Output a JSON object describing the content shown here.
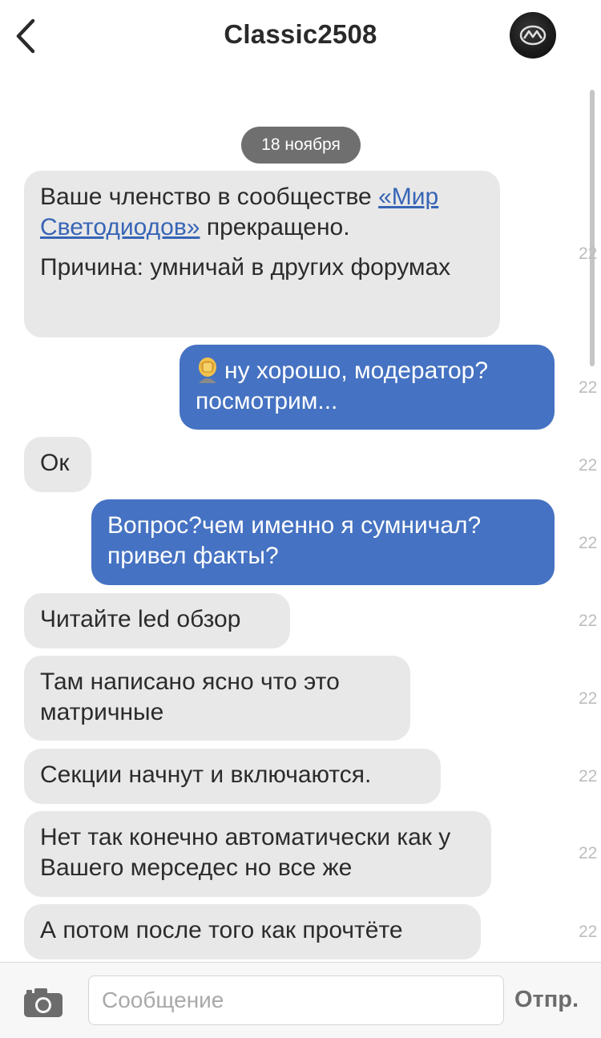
{
  "header": {
    "title": "Classic2508",
    "back_icon": "chevron-left-icon",
    "avatar_icon": "mazda-logo-avatar"
  },
  "chat": {
    "date_label": "18 ноября",
    "messages": [
      {
        "side": "in",
        "paragraphs": [
          {
            "pre": "Ваше членство в сообществе ",
            "link": "«Мир Светодиодов»",
            "post": " прекращено."
          },
          {
            "text": "Причина: умничай в других форумах"
          }
        ],
        "time": "22"
      },
      {
        "side": "out",
        "emoji": "facepalm-emoji",
        "text": "ну хорошо, модератор? посмотрим...",
        "time": "22"
      },
      {
        "side": "in",
        "text": "Ок",
        "time": "22"
      },
      {
        "side": "out",
        "text": "Вопрос?чем именно я сумничал? привел факты?",
        "time": "22"
      },
      {
        "side": "in",
        "text": "Читайте led обзор",
        "time": "22"
      },
      {
        "side": "in",
        "text": "Там написано ясно что это матричные",
        "time": "22"
      },
      {
        "side": "in",
        "text": "Секции начнут и включаются.",
        "time": "22"
      },
      {
        "side": "in",
        "text": "Нет так конечно автоматически как у Вашего мерседес но все же",
        "time": "22"
      },
      {
        "side": "in",
        "text": "А потом после того как прочтёте",
        "time": "22"
      }
    ]
  },
  "composer": {
    "camera_icon": "camera-icon",
    "placeholder": "Сообщение",
    "send_label": "Отпр."
  },
  "colors": {
    "incoming_bubble": "#e8e8e8",
    "outgoing_bubble": "#4572c2",
    "link": "#3765b6",
    "date_pill": "#6f6f6f"
  }
}
